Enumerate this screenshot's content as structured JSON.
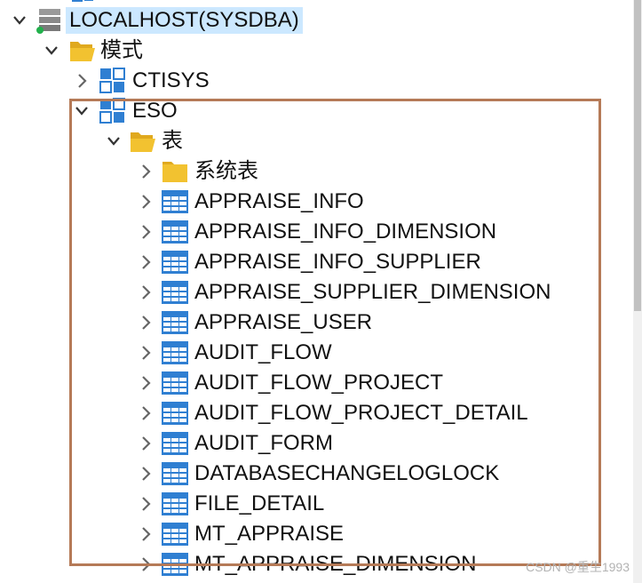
{
  "tree": {
    "connection": {
      "label": "LOCALHOST(SYSDBA)",
      "status_color": "#22b14c"
    },
    "schema_folder": {
      "label": "模式"
    },
    "schemas": [
      {
        "label": "CTISYS"
      },
      {
        "label": "ESO"
      }
    ],
    "tables_folder": {
      "label": "表"
    },
    "system_tables_folder": {
      "label": "系统表"
    },
    "tables": [
      "APPRAISE_INFO",
      "APPRAISE_INFO_DIMENSION",
      "APPRAISE_INFO_SUPPLIER",
      "APPRAISE_SUPPLIER_DIMENSION",
      "APPRAISE_USER",
      "AUDIT_FLOW",
      "AUDIT_FLOW_PROJECT",
      "AUDIT_FLOW_PROJECT_DETAIL",
      "AUDIT_FORM",
      "DATABASECHANGELOGLOCK",
      "FILE_DETAIL",
      "MT_APPRAISE",
      "MT_APPRAISE_DIMENSION"
    ]
  },
  "watermark": "CSDN @重生1993",
  "colors": {
    "folder": "#f2c230",
    "table_icon": "#2f7fd2",
    "highlight_border": "#b57a57",
    "selection": "#cce8ff"
  }
}
